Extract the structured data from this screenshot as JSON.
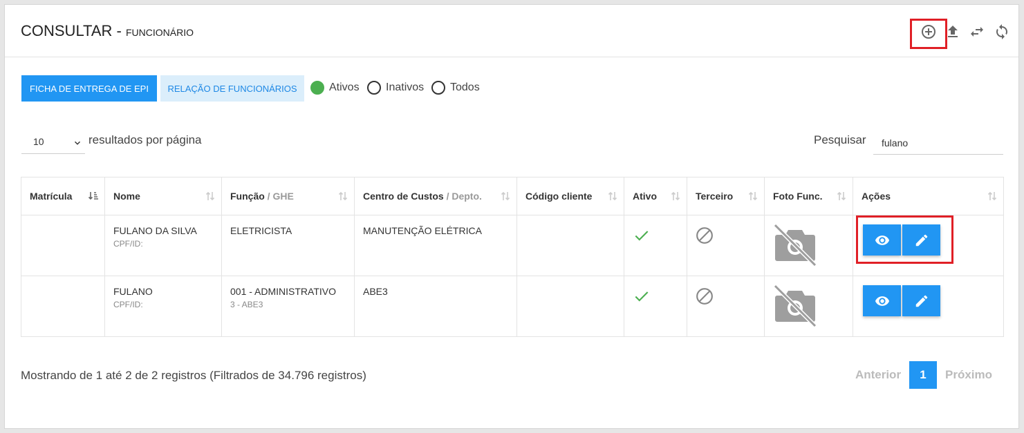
{
  "header": {
    "title": "CONSULTAR - ",
    "subtitle": "FUNCIONÁRIO"
  },
  "toolbar": {
    "icons": [
      "add-circle-icon",
      "upload-icon",
      "swap-icon",
      "refresh-icon"
    ]
  },
  "filters": {
    "btn_epi": "FICHA DE ENTREGA DE EPI",
    "btn_relacao": "RELAÇÃO DE FUNCIONÁRIOS",
    "radio": [
      {
        "label": "Ativos",
        "selected": true
      },
      {
        "label": "Inativos",
        "selected": false
      },
      {
        "label": "Todos",
        "selected": false
      }
    ]
  },
  "controls": {
    "per_page": "10",
    "per_page_label": "resultados por página",
    "search_label": "Pesquisar",
    "search_value": "fulano"
  },
  "table": {
    "columns": [
      {
        "main": "Matrícula",
        "extra": ""
      },
      {
        "main": "Nome",
        "extra": ""
      },
      {
        "main": "Função",
        "extra": " / GHE"
      },
      {
        "main": "Centro de Custos",
        "extra": " / Depto."
      },
      {
        "main": "Código cliente",
        "extra": ""
      },
      {
        "main": "Ativo",
        "extra": ""
      },
      {
        "main": "Terceiro",
        "extra": ""
      },
      {
        "main": "Foto Func.",
        "extra": ""
      },
      {
        "main": "Ações",
        "extra": ""
      }
    ],
    "rows": [
      {
        "matricula": "",
        "nome": "FULANO DA SILVA",
        "cpf": "CPF/ID:",
        "funcao": "ELETRICISTA",
        "ghe": "",
        "centro": "MANUTENÇÃO ELÉTRICA",
        "codigo": ""
      },
      {
        "matricula": "",
        "nome": "FULANO",
        "cpf": "CPF/ID:",
        "funcao": "001 - ADMINISTRATIVO",
        "ghe": "3 - ABE3",
        "centro": "ABE3",
        "codigo": ""
      }
    ]
  },
  "footer": {
    "info": "Mostrando de 1 até 2 de 2 registros (Filtrados de 34.796 registros)",
    "prev": "Anterior",
    "page": "1",
    "next": "Próximo"
  },
  "colors": {
    "primary": "#2196f3",
    "light": "#dbeefb",
    "active": "#4caf50",
    "highlight": "#e01f26"
  }
}
